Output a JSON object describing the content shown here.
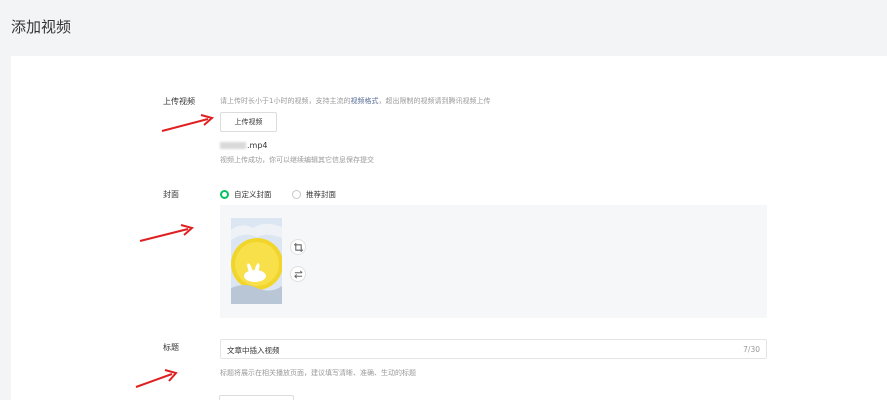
{
  "page": {
    "title": "添加视频"
  },
  "upload": {
    "label": "上传视频",
    "hint_prefix": "请上传时长小于1小时的视频，支持主流的",
    "hint_link": "视频格式",
    "hint_suffix": "，超出限制的视频请到腾讯视频上传",
    "button_label": "上传视频",
    "file_ext": ".mp4",
    "success_msg": "视频上传成功，你可以继续编辑其它信息保存提交"
  },
  "cover": {
    "label": "封面",
    "options": [
      {
        "label": "自定义封面",
        "selected": true
      },
      {
        "label": "推荐封面",
        "selected": false
      }
    ]
  },
  "title_field": {
    "label": "标题",
    "value": "文章中插入视频",
    "count": "7/30",
    "hint": "标题将展示在相关播放页面，建议填写清晰、准确、生动的标题"
  },
  "colors": {
    "accent_green": "#07c160",
    "link": "#576b95",
    "annotation_arrow": "#e02020"
  },
  "icons": {
    "crop": "crop-icon",
    "swap": "swap-icon"
  }
}
